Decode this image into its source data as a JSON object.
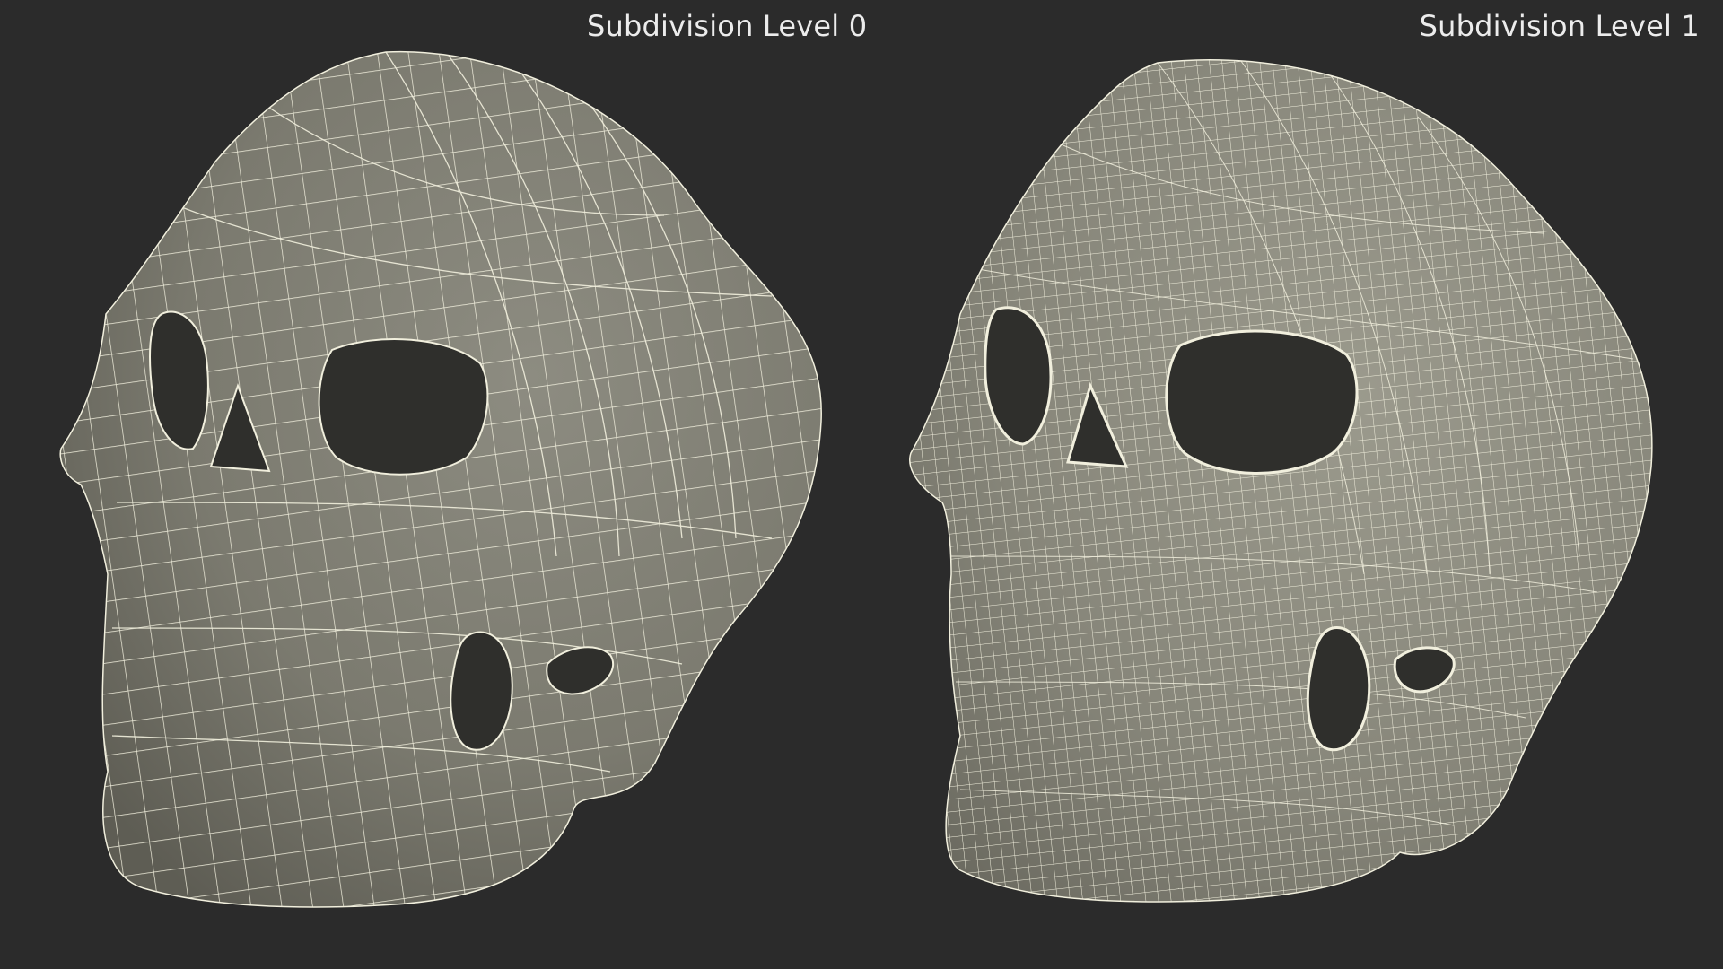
{
  "panels": [
    {
      "label": "Subdivision Level 0",
      "wire_density": "low"
    },
    {
      "label": "Subdivision Level 1",
      "wire_density": "high"
    }
  ],
  "colors": {
    "background": "#2b2b2b",
    "mesh_fill": "#7f7e73",
    "mesh_shade": "#5c5b52",
    "wire": "#f1efdd",
    "hole": "#2f2f2c",
    "label_text": "#ececec"
  }
}
